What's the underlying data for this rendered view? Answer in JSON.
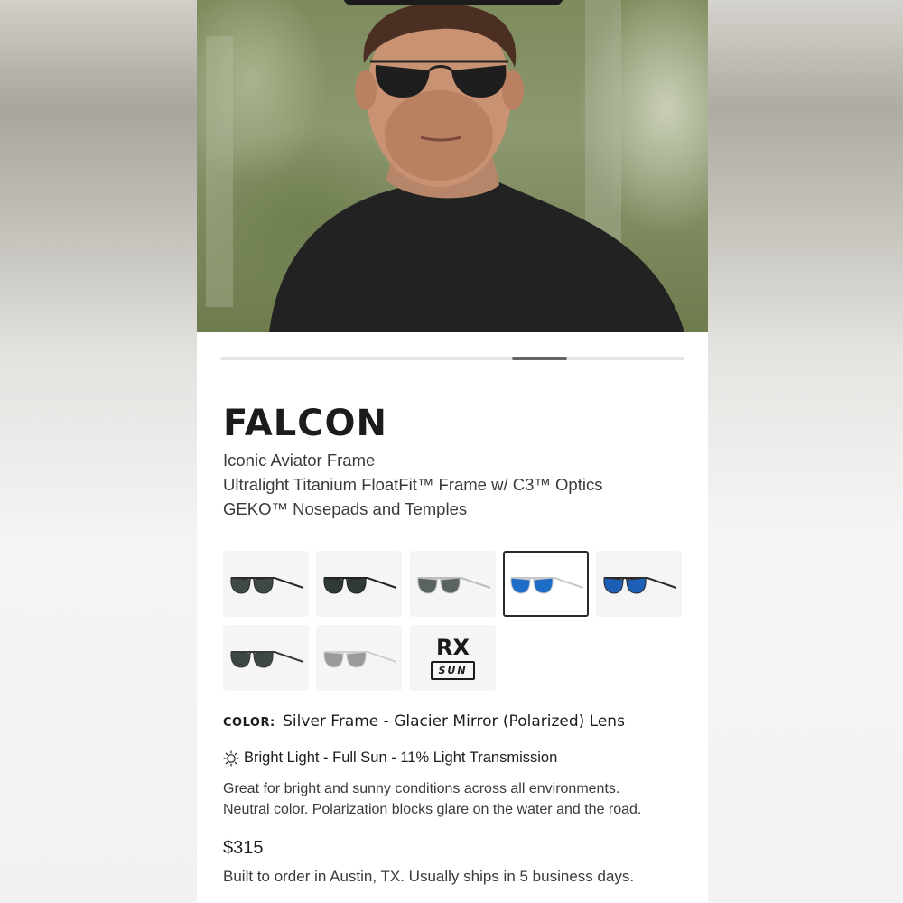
{
  "product": {
    "name": "FALCON",
    "features": [
      "Iconic Aviator Frame",
      "Ultralight Titanium FloatFit™ Frame w/ C3™ Optics",
      "GEKO™ Nosepads and Temples"
    ],
    "gallery": {
      "images": 6,
      "active_index": 4
    }
  },
  "swatches": [
    {
      "frame": "#2b2b2b",
      "lens": "#3f4a44",
      "selected": false
    },
    {
      "frame": "#222222",
      "lens": "#2f3a36",
      "selected": false
    },
    {
      "frame": "#bdbdbd",
      "lens": "#5b6460",
      "selected": false
    },
    {
      "frame": "#c8c8c8",
      "lens": "#1e6ec8",
      "selected": true
    },
    {
      "frame": "#2a2a2a",
      "lens": "#1d5fb6",
      "selected": false
    },
    {
      "frame": "#3a3a3a",
      "lens": "#3d4843",
      "selected": false
    },
    {
      "frame": "#cfcfcf",
      "lens": "#9a9a9a",
      "selected": false
    }
  ],
  "rx": {
    "top": "RX",
    "bottom": "SUN"
  },
  "color": {
    "label": "COLOR:",
    "value": "Silver Frame - Glacier Mirror (Polarized) Lens"
  },
  "light": {
    "icon": "sun-icon",
    "text": "Bright Light - Full Sun - 11% Light Transmission"
  },
  "description": [
    "Great for bright and sunny conditions across all environments.",
    "Neutral color. Polarization blocks glare on the water and the road."
  ],
  "price": "$315",
  "shipping": "Built to order in Austin, TX. Usually ships in 5 business days."
}
